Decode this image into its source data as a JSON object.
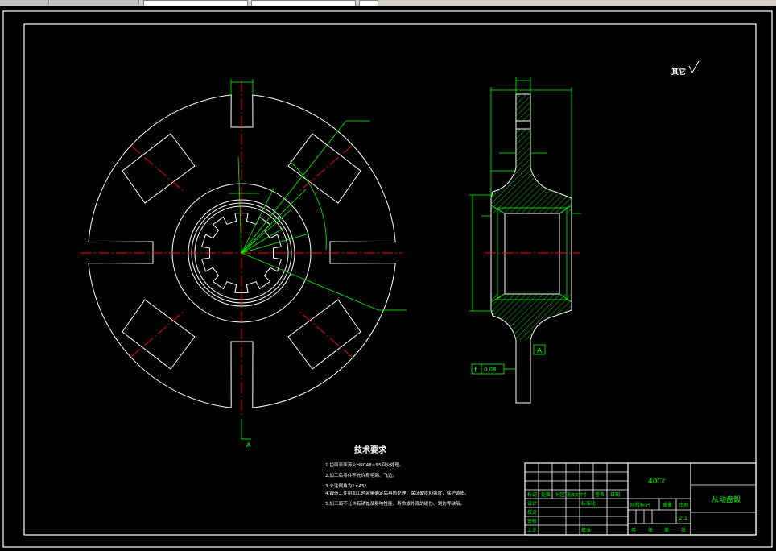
{
  "colors": {
    "background": "#000000",
    "outline": "#ffffff",
    "dimension": "#00ff00",
    "centerline": "#ff0000",
    "text": "#ffffff"
  },
  "annotations": {
    "roughness_other": "其它",
    "datum_A": "A",
    "tolerance_symbol": "f",
    "tolerance_value": "0.08",
    "section_label": "A"
  },
  "tech_requirements": {
    "title": "技术要求",
    "items": [
      "1.齿面表面淬火HRC48~55回火处理。",
      "2.加工后零件不允许有毛刺、飞边。",
      "3.未注倒角为1×45°",
      "4.锻造工件粗加工时余量确定后再热处理，保证硬度和强度，保护调质。",
      "5.加工面不允许有锈蚀及影响性能、寿命或外观的碰伤、划伤等缺陷。"
    ]
  },
  "title_block": {
    "material": "40Cr",
    "part_name": "从动盘毂",
    "scale": "2:1",
    "headers": [
      "标记",
      "处数",
      "分区",
      "更改文件号",
      "签名",
      "日期"
    ],
    "rows": [
      "设计",
      "校对",
      "审核",
      "工艺"
    ],
    "mid_labels": [
      "标准化",
      "批准"
    ],
    "stage_headers": [
      "阶段标记",
      "重量",
      "比例"
    ],
    "sheet_labels": [
      "共",
      "张",
      "第",
      "张"
    ]
  }
}
